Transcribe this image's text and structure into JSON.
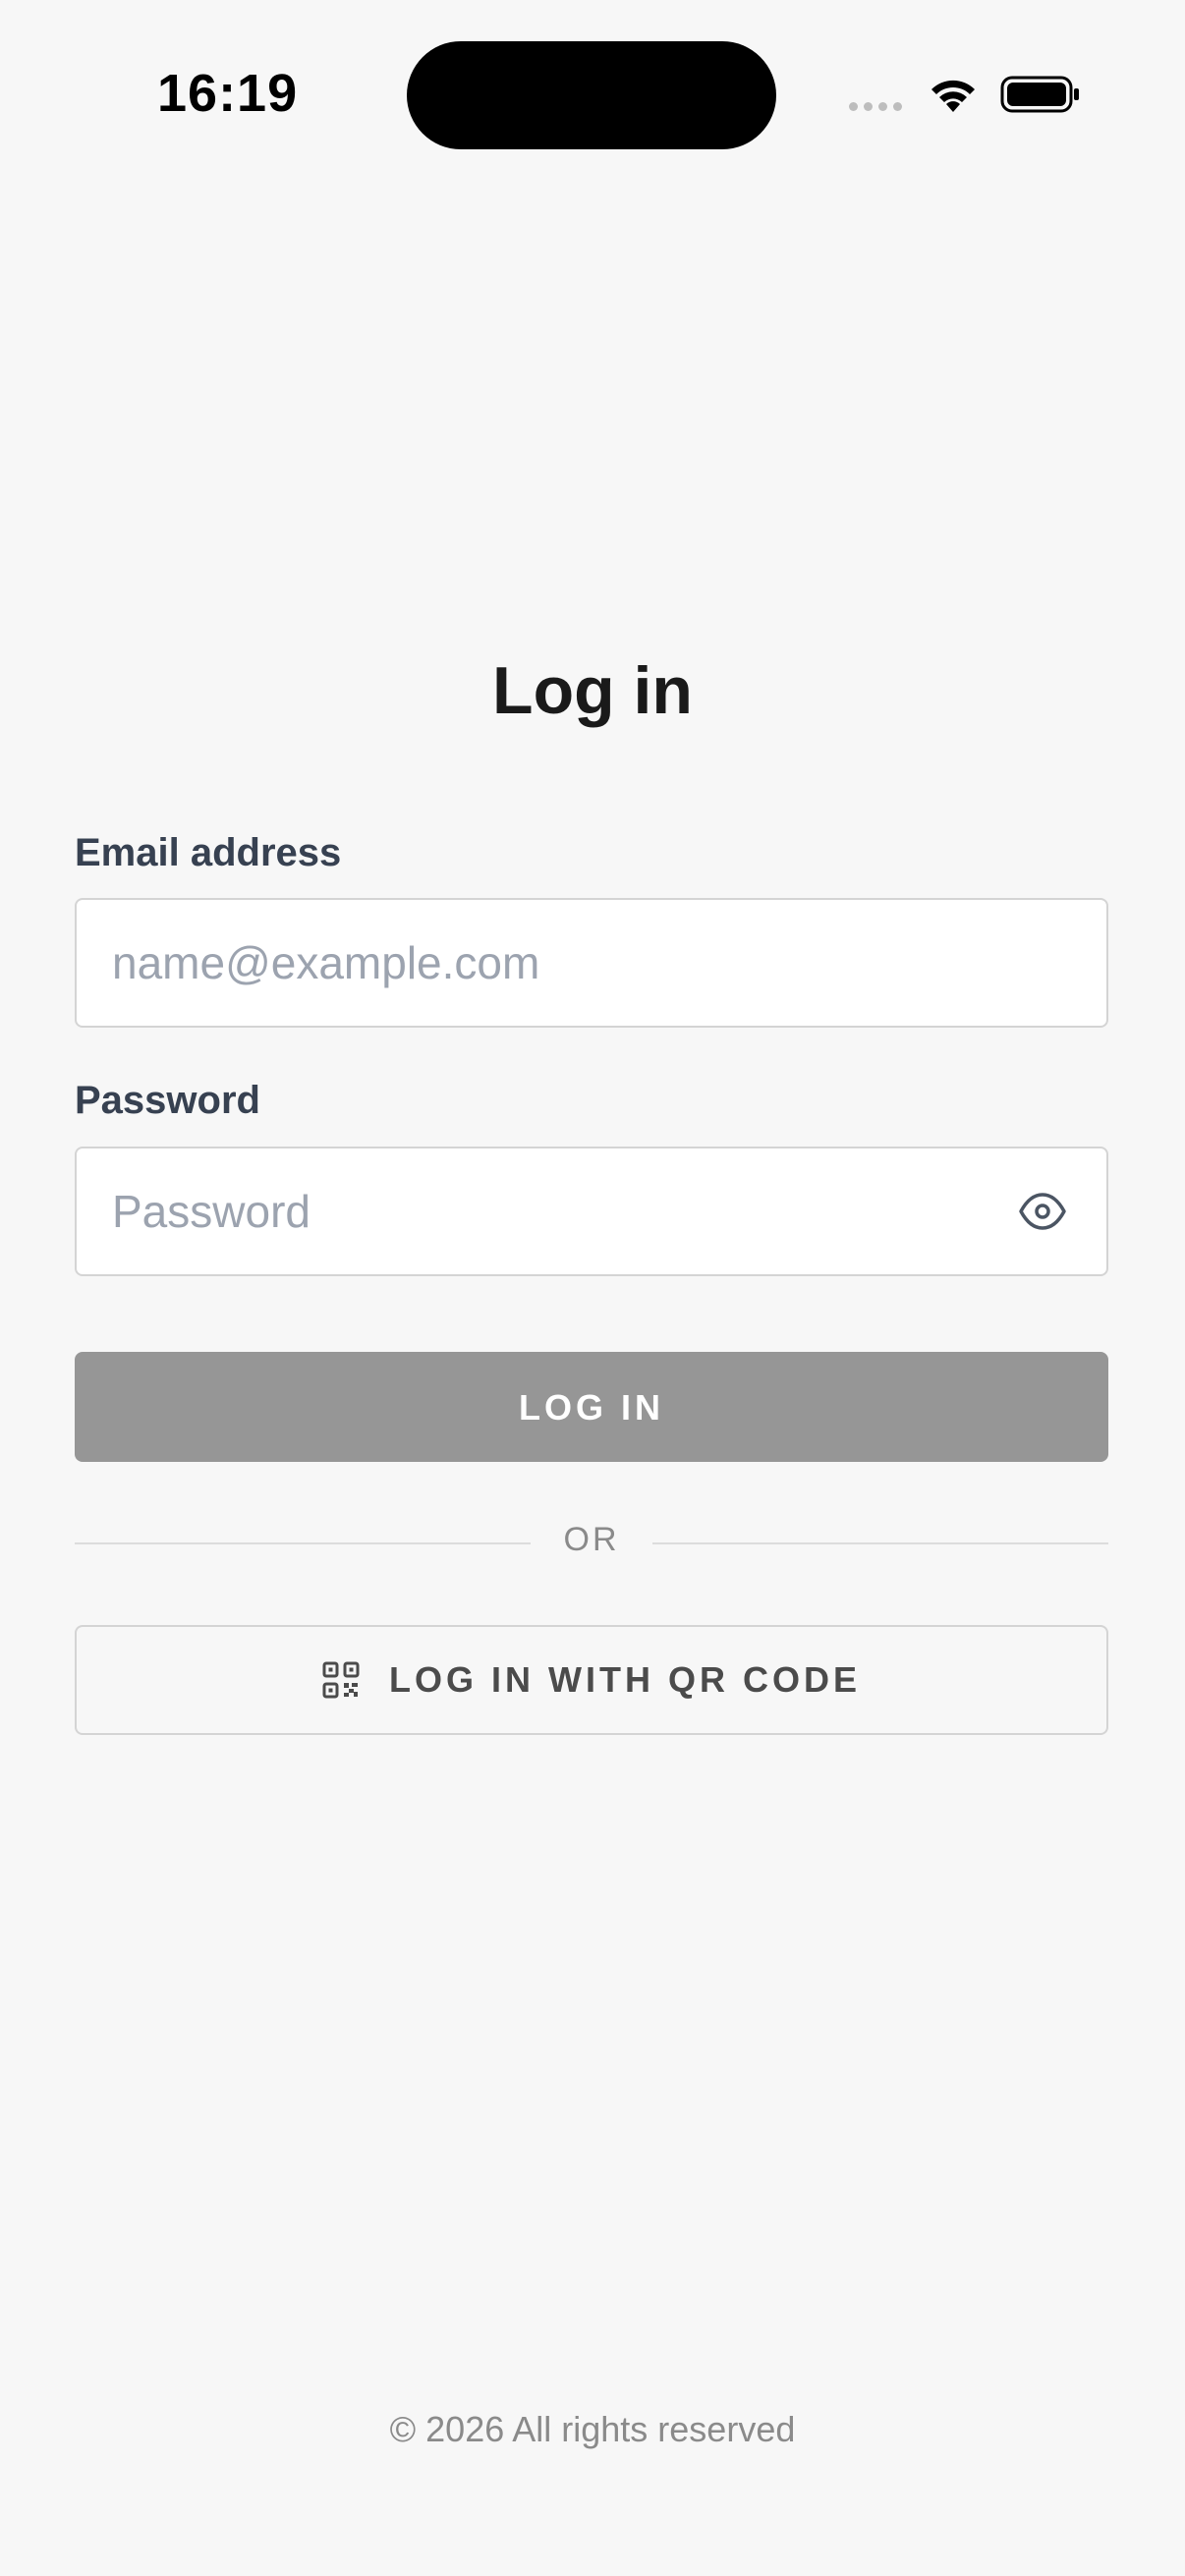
{
  "status_bar": {
    "time": "16:19"
  },
  "page": {
    "title": "Log in"
  },
  "email": {
    "label": "Email address",
    "placeholder": "name@example.com",
    "value": ""
  },
  "password": {
    "label": "Password",
    "placeholder": "Password",
    "value": ""
  },
  "actions": {
    "login_label": "LOG IN",
    "divider_label": "OR",
    "qr_login_label": "LOG IN WITH QR CODE"
  },
  "footer": {
    "copyright": "© 2026 All rights reserved"
  },
  "icons": {
    "wifi": "wifi-icon",
    "battery": "battery-icon",
    "eye": "eye-icon",
    "qr": "qr-code-icon"
  },
  "colors": {
    "background": "#f7f7f7",
    "login_button_disabled": "#969696",
    "label_text": "#374151",
    "placeholder_text": "#9ca3af"
  }
}
